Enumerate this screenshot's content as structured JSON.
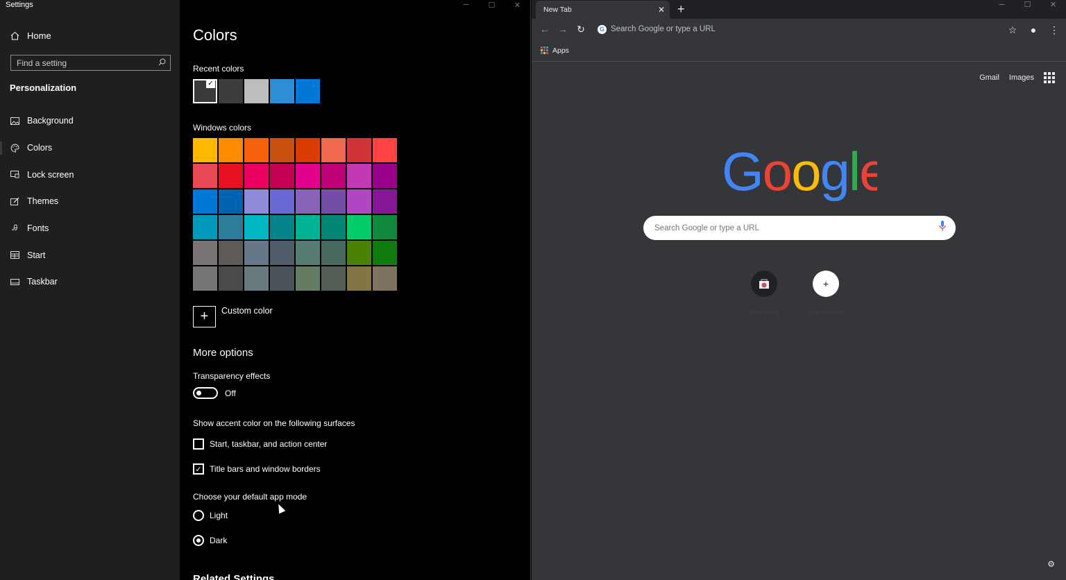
{
  "settings": {
    "window_title": "Settings",
    "nav": {
      "home": "Home",
      "search_placeholder": "Find a setting",
      "section": "Personalization",
      "items": [
        {
          "label": "Background",
          "icon": "image-icon"
        },
        {
          "label": "Colors",
          "icon": "palette-icon",
          "selected": true
        },
        {
          "label": "Lock screen",
          "icon": "lock-screen-icon"
        },
        {
          "label": "Themes",
          "icon": "themes-icon"
        },
        {
          "label": "Fonts",
          "icon": "fonts-icon"
        },
        {
          "label": "Start",
          "icon": "start-icon"
        },
        {
          "label": "Taskbar",
          "icon": "taskbar-icon"
        }
      ]
    },
    "page_title": "Colors",
    "recent_colors_label": "Recent colors",
    "recent_colors": [
      "#3a3a3a",
      "#3d3d3d",
      "#bdbdbd",
      "#2d8ed5",
      "#0078d7"
    ],
    "windows_colors_label": "Windows colors",
    "windows_colors": [
      "#ffb900",
      "#ff8c00",
      "#f7630c",
      "#ca5010",
      "#da3b01",
      "#ef6950",
      "#d13438",
      "#ff4343",
      "#e74856",
      "#e81123",
      "#ea005e",
      "#c30052",
      "#e3008c",
      "#bf0077",
      "#c239b3",
      "#9a0089",
      "#0078d7",
      "#0063b1",
      "#8e8cd8",
      "#6b69d6",
      "#8764b8",
      "#744da9",
      "#b146c2",
      "#881798",
      "#0099bc",
      "#2d7d9a",
      "#00b7c3",
      "#038387",
      "#00b294",
      "#018574",
      "#00cc6a",
      "#10893e",
      "#7a7574",
      "#5d5a58",
      "#68768a",
      "#515c6b",
      "#567c73",
      "#486860",
      "#498205",
      "#107c10",
      "#767676",
      "#4c4a48",
      "#69797e",
      "#4a5459",
      "#647c64",
      "#525e54",
      "#847545",
      "#7e735f"
    ],
    "custom_color_label": "Custom color",
    "more_options_heading": "More options",
    "transparency_label": "Transparency effects",
    "transparency_state": "Off",
    "accent_surfaces_label": "Show accent color on the following surfaces",
    "accent_start_label": "Start, taskbar, and action center",
    "accent_title_label": "Title bars and window borders",
    "app_mode_label": "Choose your default app mode",
    "app_mode_light": "Light",
    "app_mode_dark": "Dark",
    "related_settings": "Related Settings"
  },
  "chrome": {
    "tab_title": "New Tab",
    "omnibox_placeholder": "Search Google or type a URL",
    "bookmarks_apps": "Apps",
    "gmail": "Gmail",
    "images": "Images",
    "search_placeholder": "Search Google or type a URL",
    "shortcuts": [
      {
        "label": "Web Store"
      },
      {
        "label": "Add shortcut"
      }
    ],
    "logo_colors": [
      "#4285f4",
      "#ea4335",
      "#fbbc05",
      "#4285f4",
      "#34a853",
      "#ea4335"
    ]
  }
}
